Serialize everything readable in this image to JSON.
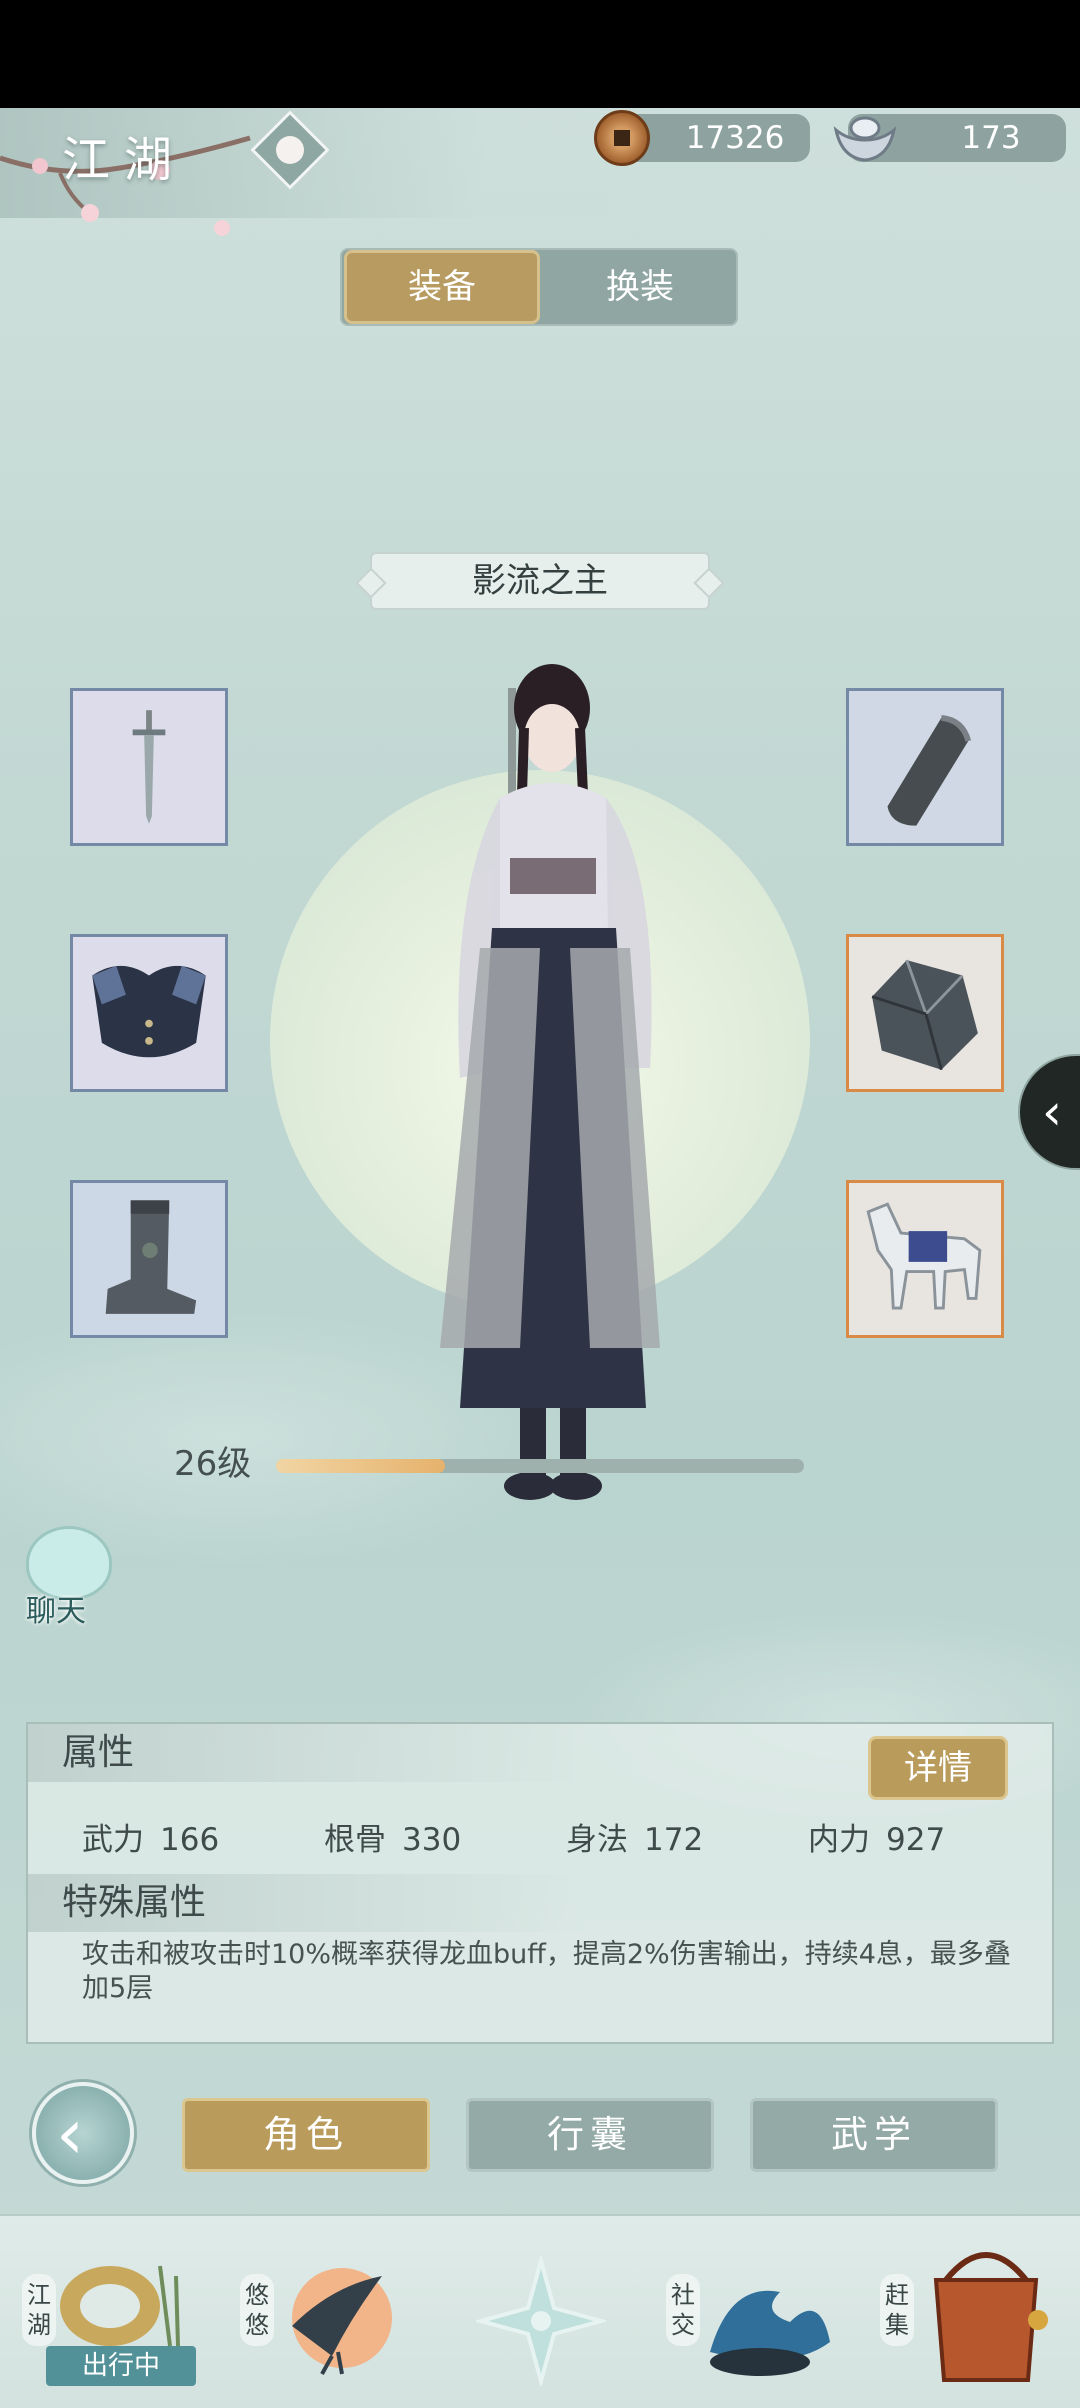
{
  "header": {
    "title": "江湖",
    "currency": [
      {
        "icon": "copper-coin-icon",
        "value": "17326"
      },
      {
        "icon": "silver-ingot-icon",
        "value": "173"
      }
    ]
  },
  "tabs": {
    "active": "装备",
    "inactive": "换装"
  },
  "character": {
    "title_plate": "影流之主",
    "level_label": "26级",
    "level_progress": 0.32
  },
  "slots": {
    "left": [
      {
        "icon": "sword-icon"
      },
      {
        "icon": "armor-icon"
      },
      {
        "icon": "boots-icon"
      }
    ],
    "right": [
      {
        "icon": "bracer-icon"
      },
      {
        "icon": "gem-icon"
      },
      {
        "icon": "horse-icon"
      }
    ]
  },
  "chat": {
    "label": "聊天"
  },
  "attributes": {
    "heading": "属性",
    "detail_button": "详情",
    "stats": [
      {
        "name": "武力",
        "value": "166"
      },
      {
        "name": "根骨",
        "value": "330"
      },
      {
        "name": "身法",
        "value": "172"
      },
      {
        "name": "内力",
        "value": "927"
      }
    ],
    "special_heading": "特殊属性",
    "special_text": "攻击和被攻击时10%概率获得龙血buff，提高2%伤害输出，持续4息，最多叠加5层"
  },
  "nav": {
    "buttons": [
      "角色",
      "行囊",
      "武学"
    ]
  },
  "dock": {
    "items": [
      {
        "label": "江湖",
        "badge": "出行中"
      },
      {
        "label": "悠悠"
      },
      {
        "label": ""
      },
      {
        "label": "社交"
      },
      {
        "label": "赶集"
      }
    ]
  },
  "colors": {
    "accent_gold": "#b99b5c",
    "panel_teal": "#93aaa6",
    "background": "#c2d8d3"
  }
}
